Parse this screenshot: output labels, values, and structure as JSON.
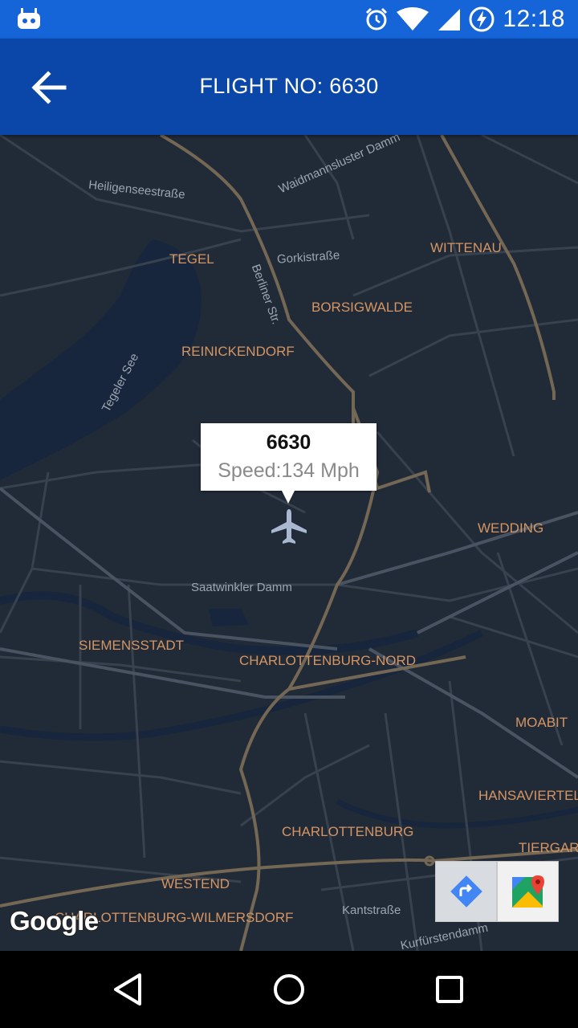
{
  "status_bar": {
    "time": "12:18",
    "icons": [
      "android-robot-icon",
      "alarm-icon",
      "wifi-icon",
      "signal-icon",
      "battery-charging-icon"
    ]
  },
  "app_bar": {
    "title": "FLIGHT NO: 6630",
    "back_icon": "arrow-back-icon"
  },
  "map": {
    "districts": {
      "tegel": "TEGEL",
      "wittenau": "WITTENAU",
      "borsigwalde": "BORSIGWALDE",
      "reinickendorf": "REINICKENDORF",
      "wedding": "WEDDING",
      "siemensstadt": "SIEMENSSTADT",
      "charlottenburg_nord": "CHARLOTTENBURG-NORD",
      "moabit": "MOABIT",
      "hansaviertel": "HANSAVIERTEL",
      "charlottenburg": "CHARLOTTENBURG",
      "tiergarten": "TIERGART",
      "westend": "WESTEND",
      "charlottenburg_wilmersdorf": "CHARLOTTENBURG-WILMERSDORF"
    },
    "streets": {
      "heiligensee": "Heiligenseestraße",
      "waidmannsluster": "Waidmannsluster Damm",
      "gorki": "Gorkistraße",
      "berliner": "Berliner Str.",
      "tegeler_see": "Tegeler See",
      "saatwinkler": "Saatwinkler Damm",
      "kant": "Kantstraße",
      "kurfuersten": "Kurfürstendamm"
    },
    "marker": {
      "flight_number": "6630",
      "speed": "Speed:134 Mph",
      "icon": "airplane-icon"
    },
    "attribution": "Google",
    "buttons": {
      "directions_icon": "directions-icon",
      "maps_icon": "google-maps-icon"
    },
    "colors": {
      "background": "#212a37",
      "water": "#17263c",
      "road": "#38414e",
      "highway": "#746855",
      "label": "#d59563"
    }
  },
  "nav_bar": {
    "icons": [
      "back-triangle-icon",
      "home-circle-icon",
      "recents-square-icon"
    ]
  }
}
